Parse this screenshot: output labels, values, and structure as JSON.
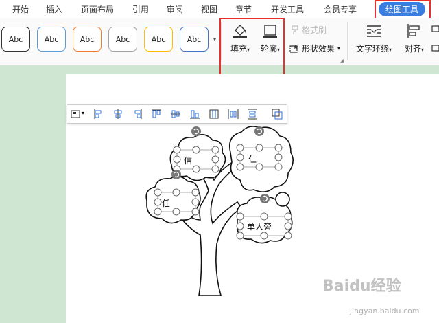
{
  "menubar": {
    "tabs": [
      "开始",
      "插入",
      "页面布局",
      "引用",
      "审阅",
      "视图",
      "章节",
      "开发工具",
      "会员专享",
      "绘图工具"
    ],
    "active_tab": "绘图工具"
  },
  "ribbon": {
    "style_swatches": [
      {
        "label": "Abc",
        "border": "#333333"
      },
      {
        "label": "Abc",
        "border": "#5b9bd5"
      },
      {
        "label": "Abc",
        "border": "#ed7d31"
      },
      {
        "label": "Abc",
        "border": "#a5a5a5"
      },
      {
        "label": "Abc",
        "border": "#ffc000"
      },
      {
        "label": "Abc",
        "border": "#4472c4"
      }
    ],
    "fill_label": "填充",
    "outline_label": "轮廓",
    "format_painter_label": "格式刷",
    "shape_effects_label": "形状效果",
    "text_wrap_label": "文字环绕",
    "align_label": "对齐"
  },
  "clouds": {
    "xin": "信",
    "ren_benevolence": "仁",
    "ren_trust": "任",
    "dan_ren_pang": "单人旁"
  },
  "watermark": {
    "brand": "Baidu经验",
    "url": "jingyan.baidu.com"
  },
  "colors": {
    "accent": "#3a7de0",
    "highlight": "#e53030",
    "page_bg": "#cfe6d3"
  }
}
